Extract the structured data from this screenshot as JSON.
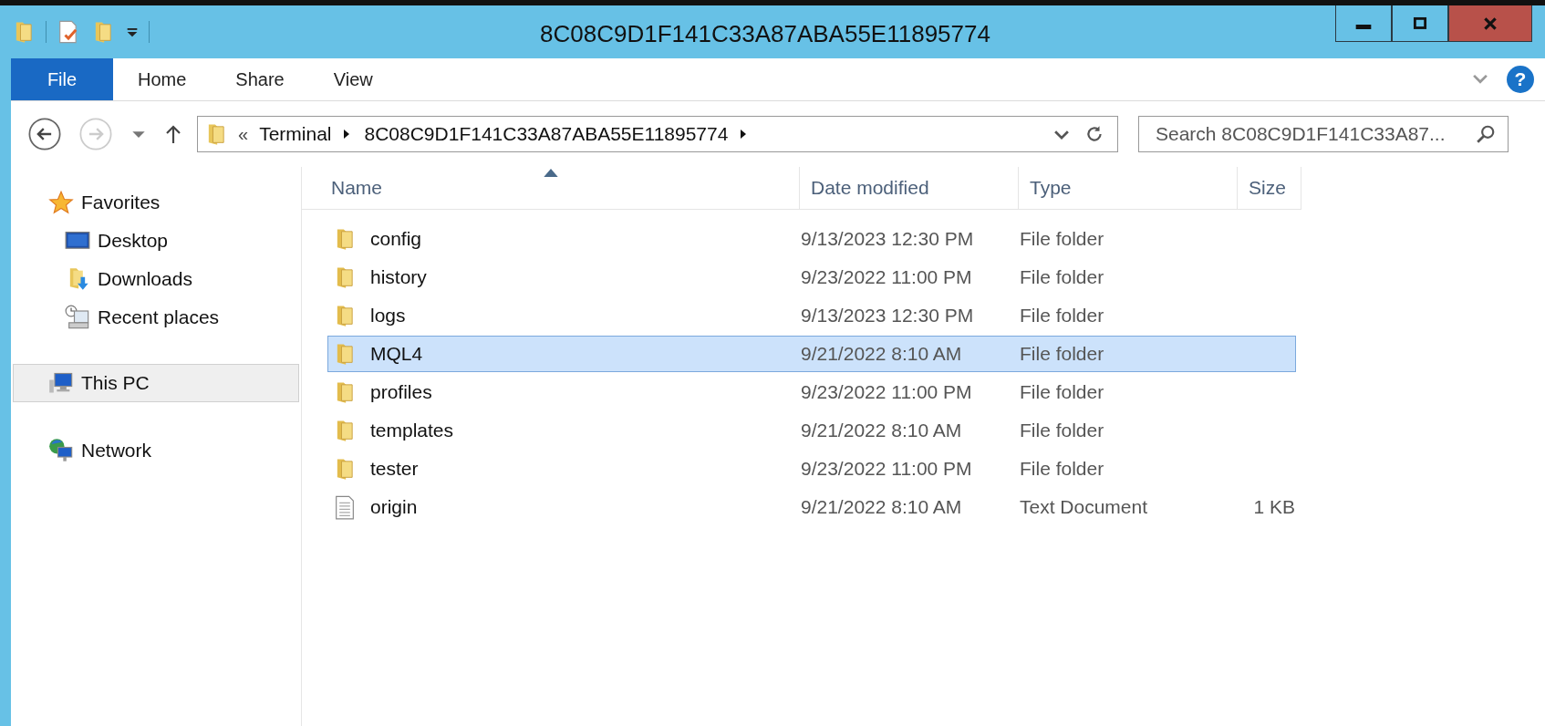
{
  "window": {
    "title": "8C08C9D1F141C33A87ABA55E11895774"
  },
  "ribbon": {
    "tabs": [
      {
        "label": "File",
        "kind": "file",
        "selected": false
      },
      {
        "label": "Home",
        "kind": "tab",
        "selected": false
      },
      {
        "label": "Share",
        "kind": "tab",
        "selected": false
      },
      {
        "label": "View",
        "kind": "tab",
        "selected": false
      }
    ]
  },
  "address_bar": {
    "overflow": "«",
    "segments": [
      "Terminal",
      "8C08C9D1F141C33A87ABA55E11895774"
    ]
  },
  "help": "?",
  "search": {
    "placeholder": "Search 8C08C9D1F141C33A87..."
  },
  "sidebar": {
    "items": [
      {
        "label": "Favorites",
        "kind": "favorites",
        "selected": false,
        "children": [
          {
            "label": "Desktop",
            "kind": "desktop",
            "selected": false
          },
          {
            "label": "Downloads",
            "kind": "downloads",
            "selected": false
          },
          {
            "label": "Recent places",
            "kind": "recent",
            "selected": false
          }
        ]
      },
      {
        "label": "This PC",
        "kind": "pc",
        "selected": true
      },
      {
        "label": "Network",
        "kind": "network",
        "selected": false
      }
    ]
  },
  "table": {
    "columns": [
      {
        "label": "Name",
        "sorted": true
      },
      {
        "label": "Date modified",
        "sorted": false
      },
      {
        "label": "Type",
        "sorted": false
      },
      {
        "label": "Size",
        "sorted": false
      }
    ],
    "rows": [
      {
        "name": "config",
        "date": "9/13/2023 12:30 PM",
        "type": "File folder",
        "kind": "folder",
        "selected": false
      },
      {
        "name": "history",
        "date": "9/23/2022 11:00 PM",
        "type": "File folder",
        "kind": "folder",
        "selected": false
      },
      {
        "name": "logs",
        "date": "9/13/2023 12:30 PM",
        "type": "File folder",
        "kind": "folder",
        "selected": false
      },
      {
        "name": "MQL4",
        "date": "9/21/2022 8:10 AM",
        "type": "File folder",
        "kind": "folder",
        "selected": true
      },
      {
        "name": "profiles",
        "date": "9/23/2022 11:00 PM",
        "type": "File folder",
        "kind": "folder",
        "selected": false
      },
      {
        "name": "templates",
        "date": "9/21/2022 8:10 AM",
        "type": "File folder",
        "kind": "folder",
        "selected": false
      },
      {
        "name": "tester",
        "date": "9/23/2022 11:00 PM",
        "type": "File folder",
        "kind": "folder",
        "selected": false
      },
      {
        "name": "origin",
        "date": "9/21/2022 8:10 AM",
        "type": "Text Document",
        "size": "1 KB",
        "kind": "document",
        "selected": false
      }
    ]
  }
}
